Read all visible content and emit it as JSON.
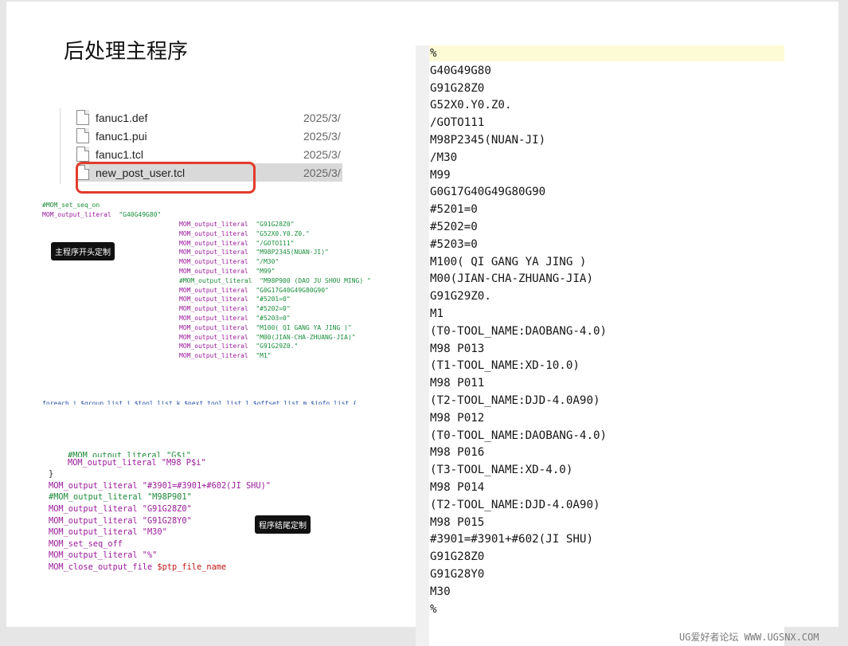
{
  "title": "后处理主程序",
  "files": [
    {
      "name": "fanuc1.def",
      "date": "2025/3/"
    },
    {
      "name": "fanuc1.pui",
      "date": "2025/3/"
    },
    {
      "name": "fanuc1.tcl",
      "date": "2025/3/"
    },
    {
      "name": "new_post_user.tcl",
      "date": "2025/3/"
    }
  ],
  "code_top": {
    "line1": "#MOM_set_seq_on",
    "line2_kw": "MOM_output_literal",
    "line2_str": "\"G40G49G80\"",
    "lines": [
      {
        "kw": "MOM_output_literal",
        "str": "\"G91G28Z0\""
      },
      {
        "kw": "MOM_output_literal",
        "str": "\"G52X0.Y0.Z0.\""
      },
      {
        "kw": "MOM_output_literal",
        "str": "\"/GOTO111\""
      },
      {
        "kw": "MOM_output_literal",
        "str": "\"M98P2345(NUAN-JI)\""
      },
      {
        "kw": "MOM_output_literal",
        "str": "\"/M30\""
      },
      {
        "kw": "MOM_output_literal",
        "str": "\"M99\""
      },
      {
        "kw": "#MOM_output_literal",
        "str": "\"M98P900 (DAO JU SHOU MING) \""
      },
      {
        "kw": "MOM_output_literal",
        "str": "\"G0G17G40G49G80G90\""
      },
      {
        "kw": "MOM_output_literal",
        "str": "\"#5201=0\""
      },
      {
        "kw": "MOM_output_literal",
        "str": "\"#5202=0\""
      },
      {
        "kw": "MOM_output_literal",
        "str": "\"#5203=0\""
      },
      {
        "kw": "MOM_output_literal",
        "str": "\"M100( QI GANG YA JING )\""
      },
      {
        "kw": "MOM_output_literal",
        "str": "\"M00(JIAN-CHA-ZHUANG-JIA)\""
      },
      {
        "kw": "MOM_output_literal",
        "str": "\"G91G29Z0.\""
      },
      {
        "kw": "MOM_output_literal",
        "str": "\"M1\""
      }
    ]
  },
  "badge_start": "主程序开头定制",
  "foreach_line": "foreach i $group_list j $tool_list k $next_tool_list l $offset_list m $info_list {",
  "code_bottom": {
    "partial": "#MOM_output_literal \"G$i\"",
    "m98": "MOM_output_literal \"M98 P$i\"",
    "brace": "}",
    "lines": [
      "MOM_output_literal \"#3901=#3901+#602(JI SHU)\"",
      "#MOM_output_literal \"M98P901\"",
      "MOM_output_literal \"G91G28Z0\"",
      "MOM_output_literal \"G91G28Y0\"",
      "MOM_output_literal \"M30\"",
      "MOM_set_seq_off",
      "MOM_output_literal \"%\""
    ],
    "close_cmd": "MOM_close_output_file",
    "close_arg": "$ptp_file_name"
  },
  "badge_end": "程序结尾定制",
  "nc_output": [
    "%",
    "G40G49G80",
    "G91G28Z0",
    "G52X0.Y0.Z0.",
    "/GOTO111",
    "M98P2345(NUAN-JI)",
    "/M30",
    "M99",
    "G0G17G40G49G80G90",
    "#5201=0",
    "#5202=0",
    "#5203=0",
    "M100( QI GANG YA JING )",
    "M00(JIAN-CHA-ZHUANG-JIA)",
    "G91G29Z0.",
    "M1",
    "(T0-TOOL_NAME:DAOBANG-4.0)",
    "M98 P013",
    "(T1-TOOL_NAME:XD-10.0)",
    "M98 P011",
    "(T2-TOOL_NAME:DJD-4.0A90)",
    "M98 P012",
    "(T0-TOOL_NAME:DAOBANG-4.0)",
    "M98 P016",
    "(T3-TOOL_NAME:XD-4.0)",
    "M98 P014",
    "(T2-TOOL_NAME:DJD-4.0A90)",
    "M98 P015",
    "#3901=#3901+#602(JI SHU)",
    "G91G28Z0",
    "G91G28Y0",
    "M30",
    "%"
  ],
  "watermark": "UG爱好者论坛 WWW.UGSNX.COM",
  "colors": {
    "keyword": "#9b1b9b",
    "string": "#1a8f3c",
    "highlight": "#fdfbd5",
    "red_box": "#e33b2b"
  }
}
